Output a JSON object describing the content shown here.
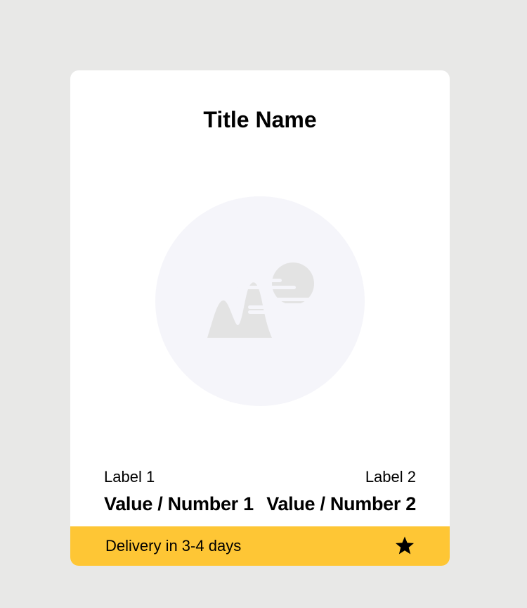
{
  "card": {
    "title": "Title Name",
    "image": {
      "icon": "image-placeholder-icon",
      "circle_color": "#f5f5fa",
      "shape_color": "#e3e3e3"
    },
    "stats": [
      {
        "label": "Label 1",
        "value": "Value / Number 1"
      },
      {
        "label": "Label 2",
        "value": "Value / Number 2"
      }
    ],
    "footer": {
      "delivery_text": "Delivery in 3-4 days",
      "star_icon": "star-icon",
      "background": "#fec635"
    }
  }
}
